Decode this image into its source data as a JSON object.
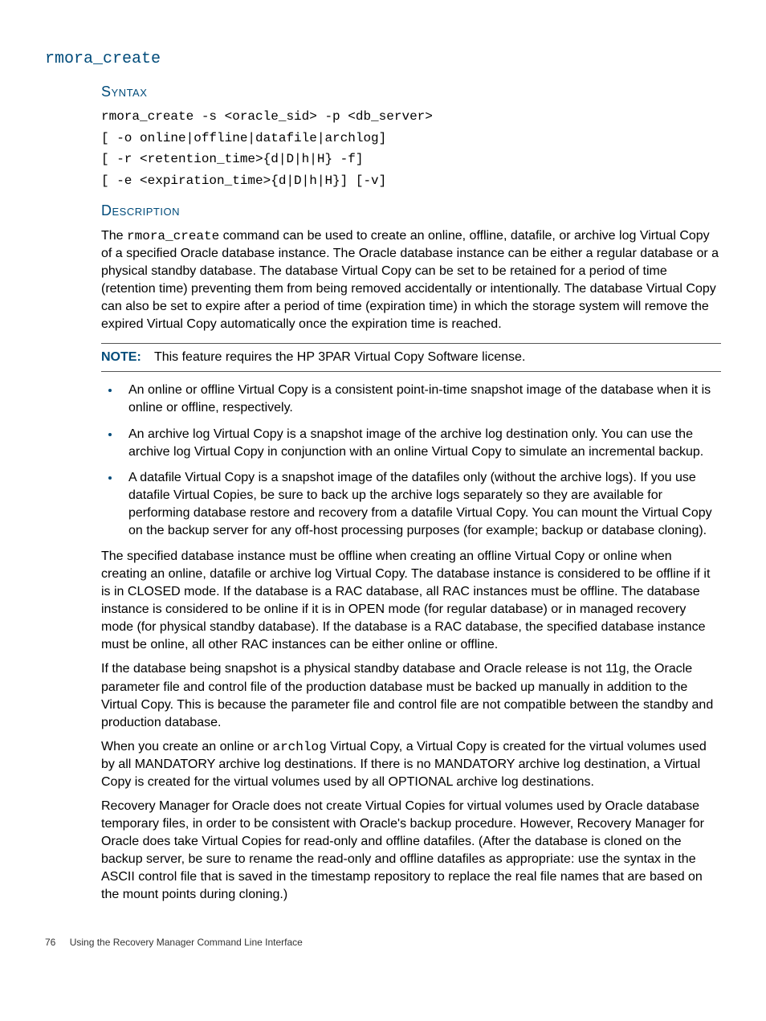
{
  "command_name": "rmora_create",
  "syntax": {
    "heading": "Syntax",
    "code": "rmora_create -s <oracle_sid> -p <db_server>\n[ -o online|offline|datafile|archlog]\n[ -r <retention_time>{d|D|h|H} -f]\n[ -e <expiration_time>{d|D|h|H}] [-v]"
  },
  "description": {
    "heading": "Description",
    "intro_pre": "The ",
    "intro_cmd": "rmora_create",
    "intro_post": " command can be used to create an online, offline, datafile, or archive log Virtual Copy of a specified Oracle database instance. The Oracle database instance can be either a regular database or a physical standby database. The database Virtual Copy can be set to be retained for a period of time (retention time) preventing them from being removed accidentally or intentionally. The database Virtual Copy can also be set to expire after a period of time (expiration time) in which the storage system will remove the expired Virtual Copy automatically once the expiration time is reached.",
    "note_label": "NOTE:",
    "note_text": "This feature requires the HP 3PAR Virtual Copy Software license.",
    "bullets": [
      "An online or offline Virtual Copy is a consistent point-in-time snapshot image of the database when it is online or offline, respectively.",
      "An archive log Virtual Copy is a snapshot image of the archive log destination only. You can use the archive log Virtual Copy in conjunction with an online Virtual Copy to simulate an incremental backup.",
      "A datafile Virtual Copy is a snapshot image of the datafiles only (without the archive logs). If you use datafile Virtual Copies, be sure to back up the archive logs separately so they are available for performing database restore and recovery from a datafile Virtual Copy. You can mount the Virtual Copy on the backup server for any off-host processing purposes (for example; backup or database cloning)."
    ],
    "para2": "The specified database instance must be offline when creating an offline Virtual Copy or online when creating an online, datafile or archive log Virtual Copy. The database instance is considered to be offline if it is in CLOSED mode. If the database is a RAC database, all RAC instances must be offline. The database instance is considered to be online if it is in OPEN mode (for regular database) or in managed recovery mode (for physical standby database). If the database is a RAC database, the specified database instance must be online, all other RAC instances can be either online or offline.",
    "para3": "If the database being snapshot is a physical standby database and Oracle release is not 11g, the Oracle parameter file and control file of the production database must be backed up manually in addition to the Virtual Copy. This is because the parameter file and control file are not compatible between the standby and production database.",
    "para4_pre": "When you create an online or ",
    "para4_cmd": "archlog",
    "para4_post": " Virtual Copy, a Virtual Copy is created for the virtual volumes used by all MANDATORY archive log destinations. If there is no MANDATORY archive log destination, a Virtual Copy is created for the virtual volumes used by all OPTIONAL archive log destinations.",
    "para5": "Recovery Manager for Oracle does not create Virtual Copies for virtual volumes used by Oracle database temporary files, in order to be consistent with Oracle's backup procedure. However, Recovery Manager for Oracle does take Virtual Copies for read-only and offline datafiles. (After the database is cloned on the backup server, be sure to rename the read-only and offline datafiles as appropriate: use the syntax in the ASCII control file that is saved in the timestamp repository to replace the real file names that are based on the mount points during cloning.)"
  },
  "footer": {
    "page_number": "76",
    "section_title": "Using the Recovery Manager Command Line Interface"
  }
}
